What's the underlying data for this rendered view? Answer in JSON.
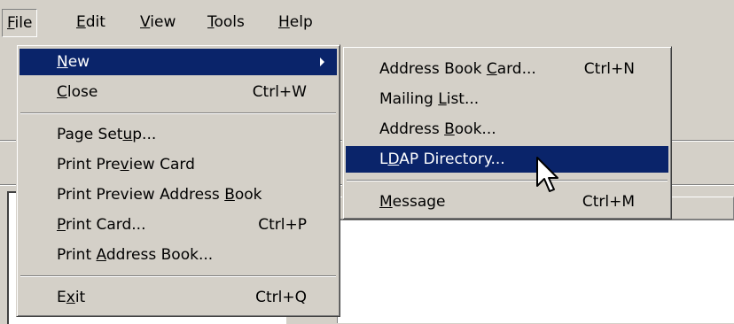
{
  "menubar": {
    "items": [
      {
        "pre": "",
        "key": "F",
        "post": "ile"
      },
      {
        "pre": "",
        "key": "E",
        "post": "dit"
      },
      {
        "pre": "",
        "key": "V",
        "post": "iew"
      },
      {
        "pre": "",
        "key": "T",
        "post": "ools"
      },
      {
        "pre": "",
        "key": "H",
        "post": "elp"
      }
    ]
  },
  "file_menu": {
    "items": [
      {
        "pre": "",
        "key": "N",
        "post": "ew",
        "shortcut": ""
      },
      {
        "pre": "",
        "key": "C",
        "post": "lose",
        "shortcut": "Ctrl+W"
      },
      {
        "pre": "Page Set",
        "key": "u",
        "post": "p...",
        "shortcut": ""
      },
      {
        "pre": "Print Pre",
        "key": "v",
        "post": "iew Card",
        "shortcut": ""
      },
      {
        "pre": "Print Preview Address ",
        "key": "B",
        "post": "ook",
        "shortcut": ""
      },
      {
        "pre": "",
        "key": "P",
        "post": "rint Card...",
        "shortcut": "Ctrl+P"
      },
      {
        "pre": "Print ",
        "key": "A",
        "post": "ddress Book...",
        "shortcut": ""
      },
      {
        "pre": "E",
        "key": "x",
        "post": "it",
        "shortcut": "Ctrl+Q"
      }
    ]
  },
  "new_submenu": {
    "items": [
      {
        "pre": "Address Book ",
        "key": "C",
        "post": "ard...",
        "shortcut": "Ctrl+N"
      },
      {
        "pre": "Mailing ",
        "key": "L",
        "post": "ist...",
        "shortcut": ""
      },
      {
        "pre": "Address ",
        "key": "B",
        "post": "ook...",
        "shortcut": ""
      },
      {
        "pre": "L",
        "key": "D",
        "post": "AP Directory...",
        "shortcut": ""
      },
      {
        "pre": "",
        "key": "M",
        "post": "essage",
        "shortcut": "Ctrl+M"
      }
    ]
  },
  "colors": {
    "highlight": "#0a246a",
    "face": "#d4d0c8"
  }
}
